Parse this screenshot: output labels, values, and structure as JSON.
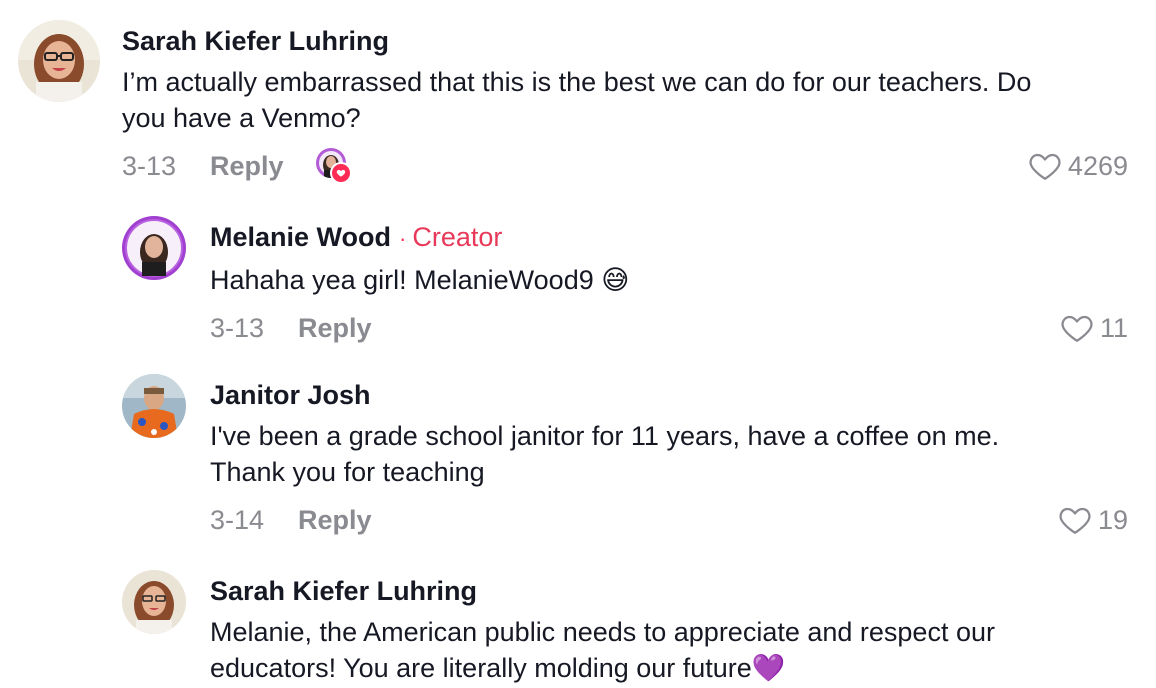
{
  "comments": [
    {
      "author": "Sarah Kiefer Luhring",
      "text": "I’m actually embarrassed that this is the best we can do for our teachers. Do\nyou have a Venmo?",
      "date": "3-13",
      "reply_label": "Reply",
      "likes": "4269",
      "liked_by_creator": true
    },
    {
      "author": "Melanie Wood",
      "creator_separator": "·",
      "creator_label": "Creator",
      "text": "Hahaha yea girl! MelanieWood9 😅",
      "date": "3-13",
      "reply_label": "Reply",
      "likes": "11"
    },
    {
      "author": "Janitor Josh",
      "text": "I've been a grade school janitor for 11 years, have a coffee on me.\nThank you for teaching",
      "date": "3-14",
      "reply_label": "Reply",
      "likes": "19"
    },
    {
      "author": "Sarah Kiefer Luhring",
      "text": "Melanie, the American public needs to appreciate and respect our\neducators! You are literally molding our future💜"
    }
  ],
  "icons": {
    "like": "heart-outline-icon",
    "creator_like_badge": "heart-icon"
  },
  "colors": {
    "creator_accent": "#e8395a",
    "like_badge": "#fe2c55",
    "secondary_text": "#8a8b91"
  }
}
